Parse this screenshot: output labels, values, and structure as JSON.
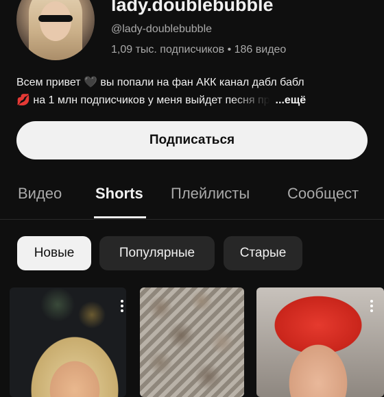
{
  "channel": {
    "name": "lady.doublebubble",
    "handle": "@lady-doublebubble",
    "stats": "1,09 тыс. подписчиков • 186 видео",
    "description_line1": "Всем привет 🖤  вы попали на фан АКК канал дабл бабл",
    "description_line2": "💋 на 1 млн подписчиков у меня выйдет песня пр",
    "more_label": "...ещё"
  },
  "subscribe_label": "Подписаться",
  "tabs": [
    {
      "label": "Видео"
    },
    {
      "label": "Shorts"
    },
    {
      "label": "Плейлисты"
    },
    {
      "label": "Сообщест"
    }
  ],
  "active_tab": "Shorts",
  "chips": [
    {
      "label": "Новые"
    },
    {
      "label": "Популярные"
    },
    {
      "label": "Старые"
    }
  ],
  "selected_chip": "Новые",
  "icons": {
    "more": "more-vert-icon"
  },
  "colors": {
    "background": "#0f0f0f",
    "text": "#f1f1f1",
    "secondary_text": "#aaaaaa",
    "chip_bg": "#272727"
  }
}
